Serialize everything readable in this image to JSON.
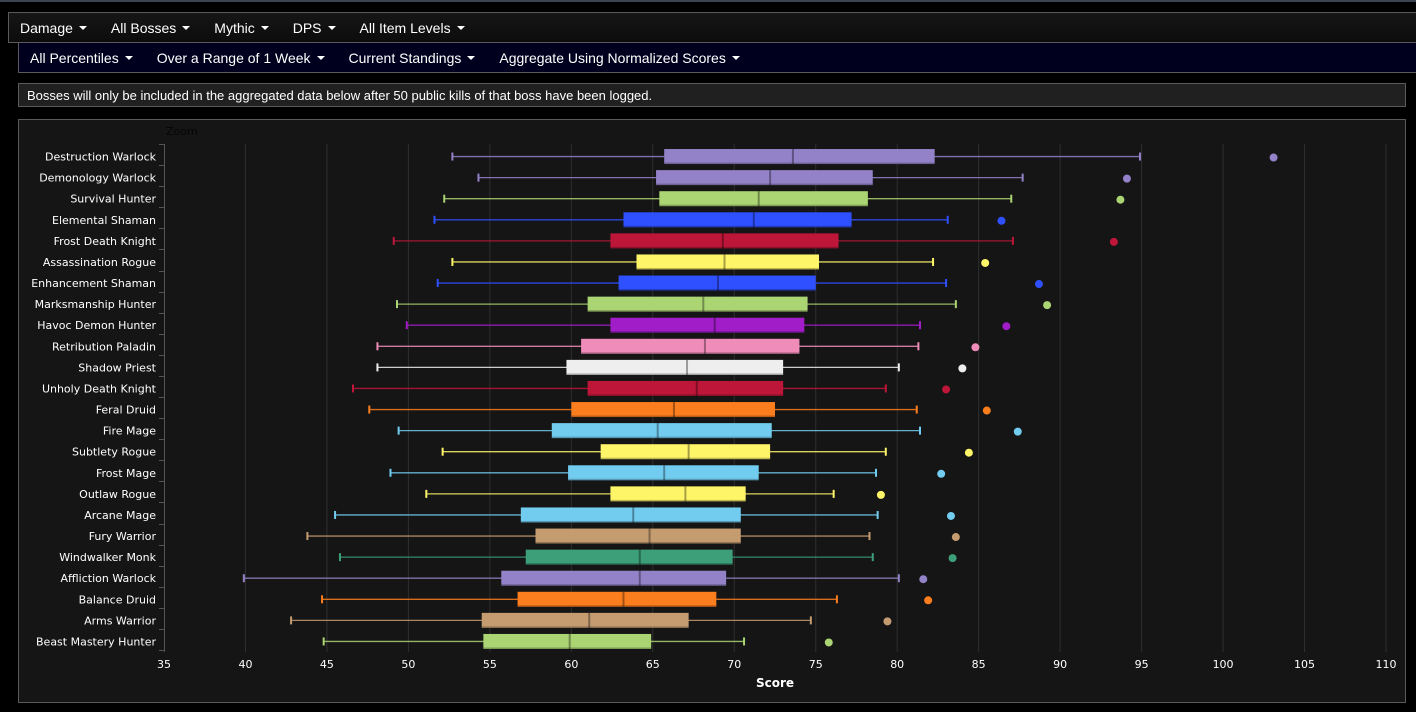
{
  "filters_row1": [
    {
      "label": "Damage"
    },
    {
      "label": "All Bosses"
    },
    {
      "label": "Mythic"
    },
    {
      "label": "DPS"
    },
    {
      "label": "All Item Levels"
    }
  ],
  "filters_row2": [
    {
      "label": "All Percentiles"
    },
    {
      "label": "Over a Range of 1 Week"
    },
    {
      "label": "Current Standings"
    },
    {
      "label": "Aggregate Using Normalized Scores"
    }
  ],
  "notice": "Bosses will only be included in the aggregated data below after 50 public kills of that boss have been logged.",
  "chart_zoom_label": "Zoom",
  "chart_data": {
    "type": "boxplot",
    "orientation": "horizontal",
    "xlabel": "Score",
    "ylabel": "",
    "xlim": [
      35,
      110
    ],
    "xticks": [
      35,
      40,
      45,
      50,
      55,
      60,
      65,
      70,
      75,
      80,
      85,
      90,
      95,
      100,
      105,
      110
    ],
    "grid": true,
    "legend": "none",
    "series": [
      {
        "name": "Destruction Warlock",
        "color": "#9482C9",
        "low": 52.7,
        "q1": 65.7,
        "median": 73.6,
        "q3": 82.3,
        "high": 94.9,
        "outlier": 103.1
      },
      {
        "name": "Demonology Warlock",
        "color": "#9482C9",
        "low": 54.3,
        "q1": 65.2,
        "median": 72.2,
        "q3": 78.5,
        "high": 87.7,
        "outlier": 94.1
      },
      {
        "name": "Survival Hunter",
        "color": "#ABD473",
        "low": 52.2,
        "q1": 65.4,
        "median": 71.5,
        "q3": 78.2,
        "high": 87.0,
        "outlier": 93.7
      },
      {
        "name": "Elemental Shaman",
        "color": "#2F50FF",
        "low": 51.6,
        "q1": 63.2,
        "median": 71.2,
        "q3": 77.2,
        "high": 83.1,
        "outlier": 86.4
      },
      {
        "name": "Frost Death Knight",
        "color": "#BE1638",
        "low": 49.1,
        "q1": 62.4,
        "median": 69.3,
        "q3": 76.4,
        "high": 87.1,
        "outlier": 93.3
      },
      {
        "name": "Assassination Rogue",
        "color": "#FFF569",
        "low": 52.7,
        "q1": 64.0,
        "median": 69.4,
        "q3": 75.2,
        "high": 82.2,
        "outlier": 85.4
      },
      {
        "name": "Enhancement Shaman",
        "color": "#2F50FF",
        "low": 51.8,
        "q1": 62.9,
        "median": 69.0,
        "q3": 75.0,
        "high": 83.0,
        "outlier": 88.7
      },
      {
        "name": "Marksmanship Hunter",
        "color": "#ABD473",
        "low": 49.3,
        "q1": 61.0,
        "median": 68.1,
        "q3": 74.5,
        "high": 83.6,
        "outlier": 89.2
      },
      {
        "name": "Havoc Demon Hunter",
        "color": "#A11DC7",
        "low": 49.9,
        "q1": 62.4,
        "median": 68.8,
        "q3": 74.3,
        "high": 81.4,
        "outlier": 86.7
      },
      {
        "name": "Retribution Paladin",
        "color": "#F08CBA",
        "low": 48.1,
        "q1": 60.6,
        "median": 68.2,
        "q3": 74.0,
        "high": 81.3,
        "outlier": 84.8
      },
      {
        "name": "Shadow Priest",
        "color": "#EEEEEE",
        "low": 48.1,
        "q1": 59.7,
        "median": 67.1,
        "q3": 73.0,
        "high": 80.1,
        "outlier": 84.0
      },
      {
        "name": "Unholy Death Knight",
        "color": "#BE1638",
        "low": 46.6,
        "q1": 61.0,
        "median": 67.7,
        "q3": 73.0,
        "high": 79.3,
        "outlier": 83.0
      },
      {
        "name": "Feral Druid",
        "color": "#FA7D1E",
        "low": 47.6,
        "q1": 60.0,
        "median": 66.3,
        "q3": 72.5,
        "high": 81.2,
        "outlier": 85.5
      },
      {
        "name": "Fire Mage",
        "color": "#72CCF0",
        "low": 49.4,
        "q1": 58.8,
        "median": 65.3,
        "q3": 72.3,
        "high": 81.4,
        "outlier": 87.4
      },
      {
        "name": "Subtlety Rogue",
        "color": "#FFF569",
        "low": 52.1,
        "q1": 61.8,
        "median": 67.2,
        "q3": 72.2,
        "high": 79.3,
        "outlier": 84.4
      },
      {
        "name": "Frost Mage",
        "color": "#72CCF0",
        "low": 48.9,
        "q1": 59.8,
        "median": 65.7,
        "q3": 71.5,
        "high": 78.7,
        "outlier": 82.7
      },
      {
        "name": "Outlaw Rogue",
        "color": "#FFF569",
        "low": 51.1,
        "q1": 62.4,
        "median": 67.0,
        "q3": 70.7,
        "high": 76.1,
        "outlier": 79.0
      },
      {
        "name": "Arcane Mage",
        "color": "#72CCF0",
        "low": 45.5,
        "q1": 56.9,
        "median": 63.8,
        "q3": 70.4,
        "high": 78.8,
        "outlier": 83.3
      },
      {
        "name": "Fury Warrior",
        "color": "#C49C70",
        "low": 43.8,
        "q1": 57.8,
        "median": 64.8,
        "q3": 70.4,
        "high": 78.3,
        "outlier": 83.6
      },
      {
        "name": "Windwalker Monk",
        "color": "#3D9E7A",
        "low": 45.8,
        "q1": 57.2,
        "median": 64.2,
        "q3": 69.9,
        "high": 78.5,
        "outlier": 83.4
      },
      {
        "name": "Affliction Warlock",
        "color": "#9482C9",
        "low": 39.9,
        "q1": 55.7,
        "median": 64.2,
        "q3": 69.5,
        "high": 80.1,
        "outlier": 81.6
      },
      {
        "name": "Balance Druid",
        "color": "#FA7D1E",
        "low": 44.7,
        "q1": 56.7,
        "median": 63.2,
        "q3": 68.9,
        "high": 76.3,
        "outlier": 81.9
      },
      {
        "name": "Arms Warrior",
        "color": "#C49C70",
        "low": 42.8,
        "q1": 54.5,
        "median": 61.1,
        "q3": 67.2,
        "high": 74.7,
        "outlier": 79.4
      },
      {
        "name": "Beast Mastery Hunter",
        "color": "#ABD473",
        "low": 44.8,
        "q1": 54.6,
        "median": 59.9,
        "q3": 64.9,
        "high": 70.6,
        "outlier": 75.8
      }
    ]
  }
}
